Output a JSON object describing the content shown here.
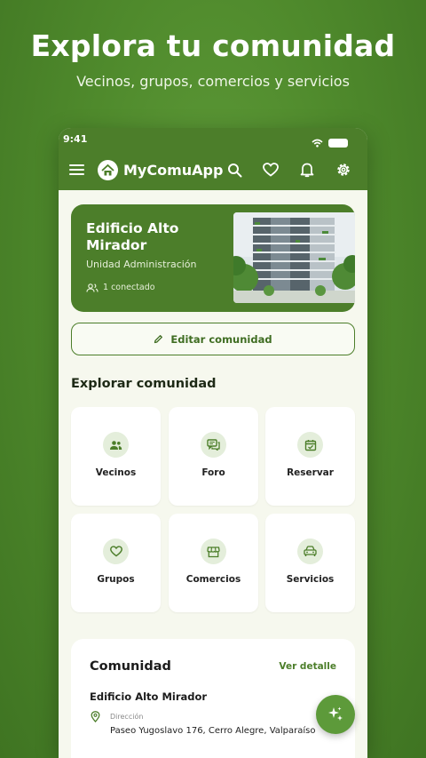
{
  "promo": {
    "title": "Explora tu comunidad",
    "subtitle": "Vecinos, grupos, comercios y servicios"
  },
  "status_bar": {
    "time": "9:41"
  },
  "app_bar": {
    "app_name": "MyComuApp",
    "icons": [
      "menu-icon",
      "app-logo-icon",
      "search-icon",
      "heart-icon",
      "bell-icon",
      "gear-icon"
    ]
  },
  "hero": {
    "name": "Edificio Alto Mirador",
    "role": "Unidad Administración",
    "connected": "1 conectado"
  },
  "edit_button": {
    "label": "Editar comunidad"
  },
  "explore": {
    "title": "Explorar comunidad",
    "tiles": [
      {
        "label": "Vecinos",
        "icon": "people-icon"
      },
      {
        "label": "Foro",
        "icon": "chat-icon"
      },
      {
        "label": "Reservar",
        "icon": "calendar-check-icon"
      },
      {
        "label": "Grupos",
        "icon": "heart-icon"
      },
      {
        "label": "Comercios",
        "icon": "store-icon"
      },
      {
        "label": "Servicios",
        "icon": "car-icon"
      }
    ]
  },
  "community_card": {
    "title": "Comunidad",
    "link": "Ver detalle",
    "building": "Edificio Alto Mirador",
    "address_label": "Dirección",
    "address_value": "Paseo Yugoslavo 176, Cerro Alegre, Valparaíso"
  },
  "fab": {
    "icon": "sparkles-icon"
  },
  "colors": {
    "primary": "#4c7e2a",
    "background": "#f6f8ee",
    "tile_icon_bg": "#e4eedb"
  }
}
